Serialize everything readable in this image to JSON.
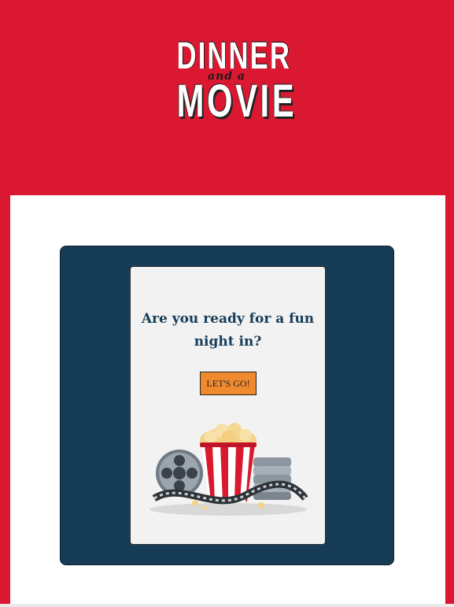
{
  "logo": {
    "line1": "DINNER",
    "line2": "and a",
    "line3": "MOVIE"
  },
  "card": {
    "question": "Are you ready for a fun night in?",
    "button_label": "LET'S GO!"
  },
  "colors": {
    "brand_red": "#da1832",
    "navy": "#173c58",
    "button_orange": "#f08a2e",
    "card_bg": "#f2f2f2"
  },
  "icons": {
    "illustration": "popcorn-film-reel-icon"
  }
}
